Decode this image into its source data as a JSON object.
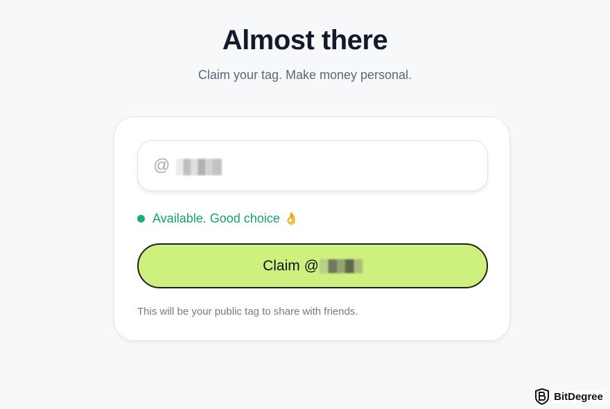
{
  "header": {
    "title": "Almost there",
    "subtitle": "Claim your tag. Make money personal."
  },
  "tag_input": {
    "prefix": "@"
  },
  "status": {
    "text": "Available. Good choice",
    "emoji": "👌",
    "color": "#13a06e"
  },
  "claim_button": {
    "label": "Claim @",
    "background": "#cdf07f"
  },
  "helper_text": "This will be your public tag to share with friends.",
  "watermark": {
    "text": "BitDegree"
  }
}
